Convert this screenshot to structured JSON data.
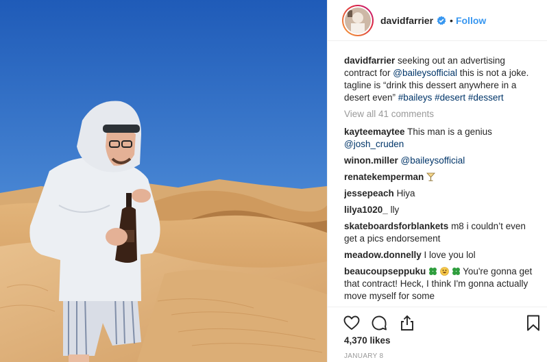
{
  "post": {
    "username": "davidfarrier",
    "follow_label": "Follow",
    "separator": "•",
    "caption": {
      "username": "davidfarrier",
      "text_1": " seeking out an advertising contract for ",
      "mention": "@baileysofficial",
      "text_2": " this is not a joke. tagline is “drink this dessert anywhere in a desert even” ",
      "hashtags": [
        "#baileys",
        "#desert",
        "#dessert"
      ]
    },
    "view_all_comments": "View all 41 comments",
    "comments": [
      {
        "username": "kayteemaytee",
        "text": " This man is a genius ",
        "mention": "@josh_cruden"
      },
      {
        "username": "winon.miller",
        "text": " ",
        "mention": "@baileysofficial"
      },
      {
        "username": "renatekemperman",
        "text": " ",
        "emoji": "cocktail-emoji"
      },
      {
        "username": "jessepeach",
        "text": " Hiya"
      },
      {
        "username": "lilya1020_",
        "text": " lly"
      },
      {
        "username": "skateboardsforblankets",
        "text": " m8 i couldn’t even get a pics endorsement"
      },
      {
        "username": "meadow.donnelly",
        "text": " I love you lol"
      },
      {
        "username": "beaucoupseppuku",
        "text_a": " ",
        "text_b": " You're gonna get that contract! Heck, I think I'm gonna actually move myself for some"
      }
    ],
    "likes": "4,370 likes",
    "date": "JANUARY 8"
  },
  "icons": {
    "verified": "verified-badge-icon",
    "like": "heart-icon",
    "comment": "comment-bubble-icon",
    "share": "share-icon",
    "save": "bookmark-icon"
  },
  "colors": {
    "link": "#003569",
    "follow": "#3897f0",
    "verified": "#3897f0",
    "muted": "#999999",
    "sky": "#2f6fc7",
    "sand": "#d9a86a"
  }
}
